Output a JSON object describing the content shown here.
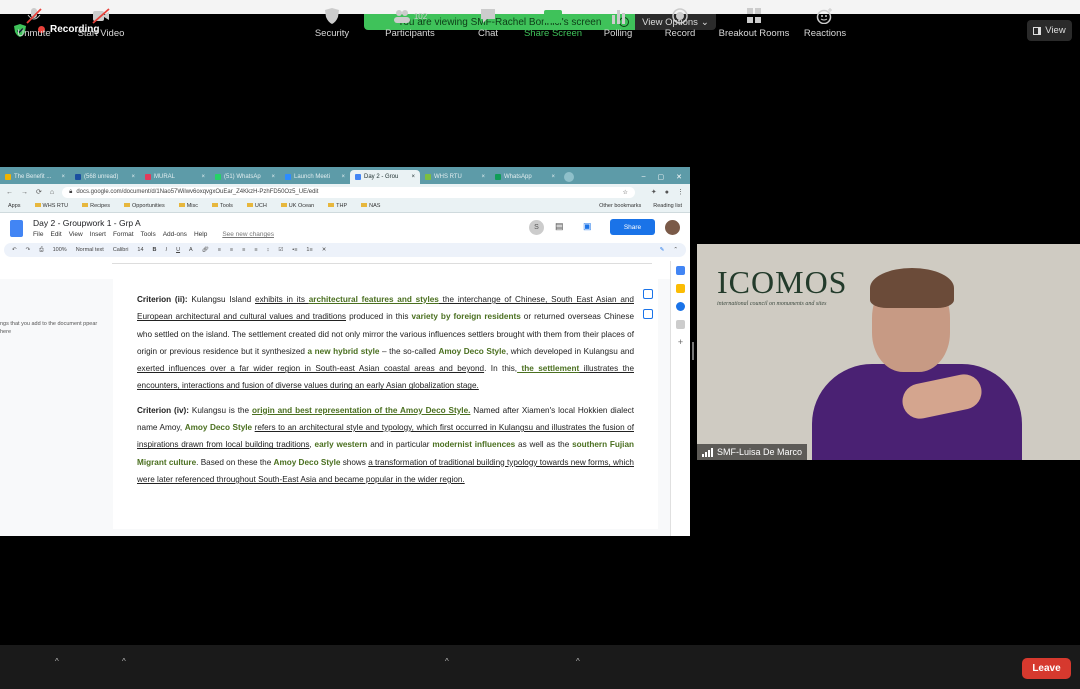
{
  "top": {
    "recording_label": "Recording",
    "viewing_banner": "You are viewing SMF-Rachel Bonnici's screen",
    "view_options": "View Options",
    "view_button": "View"
  },
  "browser": {
    "tabs": [
      "The Benefit ...",
      "(568 unread)",
      "MURAL",
      "(51) WhatsAp",
      "Launch Meeti",
      "Day 2 - Grou",
      "WHS RTU",
      "WhatsApp"
    ],
    "address": "docs.google.com/document/d/1Nao57Wilwv6oxqvgxOuEar_Z4KkzH-PzhFD50Oz5_UE/edit",
    "bookmarks": [
      "Apps",
      "WHS RTU",
      "Recipes",
      "Opportunities",
      "Misc",
      "Tools",
      "UCH",
      "UK Ocean",
      "THP",
      "NAS"
    ],
    "bookmarks_right": [
      "Other bookmarks",
      "Reading list"
    ]
  },
  "docs": {
    "title": "Day 2 - Groupwork 1 - Grp A",
    "menu": [
      "File",
      "Edit",
      "View",
      "Insert",
      "Format",
      "Tools",
      "Add-ons",
      "Help"
    ],
    "saved_note": "See new changes",
    "share_label": "Share",
    "avatar_letter": "S",
    "toolbar": {
      "zoom": "100%",
      "style": "Normal text",
      "font": "Calibri",
      "size": "14"
    },
    "outline_note": "ngs that you add to the document ppear here",
    "para1": {
      "label": "Criterion (ii):",
      "t1": " Kulangsu Island ",
      "u1": "exhibits in its ",
      "h1": "architectural features and styles",
      "u2": " the interchange of Chinese, South East Asian and European architectural and cultural values and traditions",
      "t2": " produced in this ",
      "h2": "variety by foreign residents",
      "t3": " or returned overseas Chinese who settled on the island. The settlement created did not only mirror the various influences settlers brought with them from their places of origin or previous residence but it synthesized ",
      "h3": "a new hybrid style",
      "t4": " – the so-called ",
      "h4": "Amoy Deco Style",
      "t5": ", which developed in Kulangsu and ",
      "u3": "exerted influences over a far wider region in South-east Asian coastal areas and beyond",
      "t6": ". In this,",
      "h5": " the settlement",
      "u4": " illustrates the encounters, interactions and fusion of diverse values during an early Asian globalization stage."
    },
    "para2": {
      "label": "Criterion (iv):",
      "t1": " Kulangsu is the ",
      "h1": "origin and best representation of the Amoy Deco Style.",
      "t2": " Named after Xiamen's local Hokkien dialect name Amoy, ",
      "h2": "Amoy Deco Style",
      "t3": " ",
      "u1": "refers to an architectural style and typology, which first occurred in Kulangsu and illustrates the fusion of inspirations drawn from local building traditions",
      "t4": ", ",
      "h3": "early western",
      "t5": " and in particular ",
      "h4": "modernist influences",
      "t6": " as well as the ",
      "h5": "southern Fujian Migrant culture",
      "t7": ". Based on these the ",
      "h6": "Amoy Deco Style",
      "t8": " shows ",
      "u2": "a transformation of traditional building typology towards new forms, which were later referenced throughout South-East Asia and became popular in the wider region."
    }
  },
  "video": {
    "logo_text": "ICOMOS",
    "logo_tagline": "international council on monuments and sites",
    "participant_name": "SMF-Luisa De Marco"
  },
  "bottom_bar": {
    "unmute": "Unmute",
    "start_video": "Start Video",
    "security": "Security",
    "participants": "Participants",
    "participants_count": "102",
    "chat": "Chat",
    "share_screen": "Share Screen",
    "polling": "Polling",
    "record": "Record",
    "breakout_rooms": "Breakout Rooms",
    "reactions": "Reactions",
    "leave": "Leave"
  },
  "colors": {
    "viewing_banner": "#3fc25a",
    "leave": "#d6392e",
    "docs_share": "#1a73e8",
    "highlight_text": "#4a6f1f",
    "participant_shirt": "#4a2173"
  }
}
